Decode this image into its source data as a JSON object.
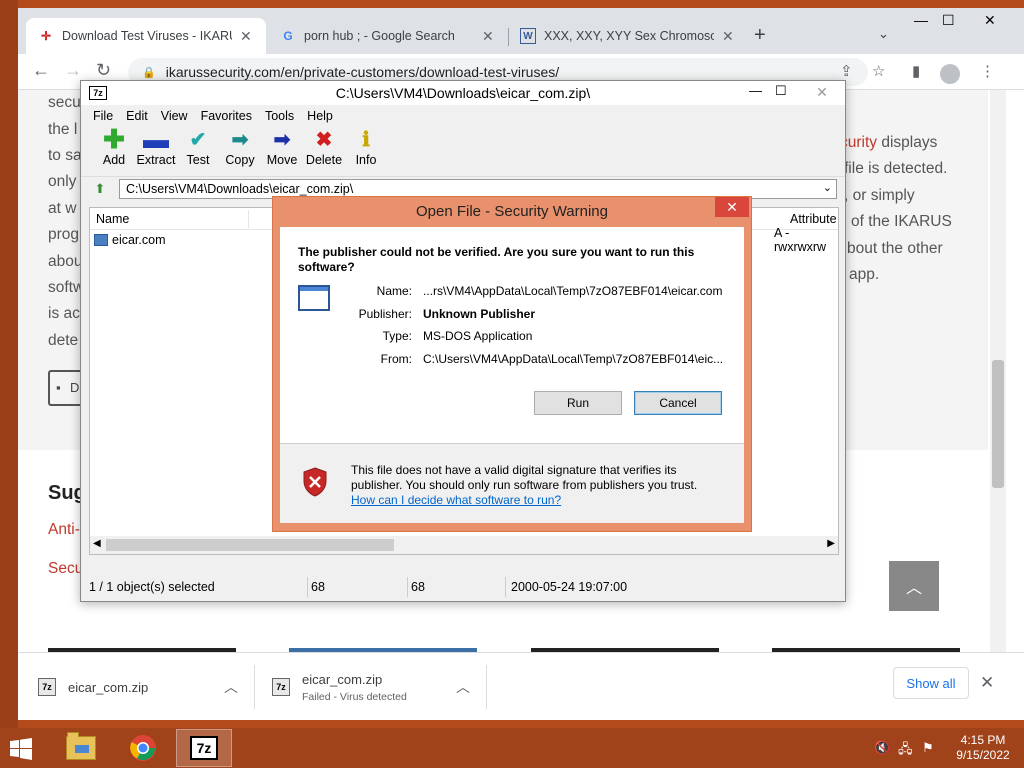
{
  "browser": {
    "tabs": [
      {
        "title": "Download Test Viruses - IKARUS",
        "favicon": "ikarus-favicon",
        "active": true
      },
      {
        "title": "porn hub ; - Google Search",
        "favicon": "google-favicon",
        "active": false
      },
      {
        "title": "XXX, XXY, XYY Sex Chromosome",
        "favicon": "wiki-favicon",
        "active": false
      }
    ],
    "url": "ikarussecurity.com/en/private-customers/download-test-viruses/"
  },
  "page": {
    "left_fragments": [
      "secu",
      "the l",
      "to sa",
      "only",
      "at w",
      "prog",
      "abou",
      "softw",
      "is ac",
      "dete"
    ],
    "right_fragments": [
      {
        "text": "curity",
        "suffix": " displays"
      },
      {
        "text": "file is detected.",
        "suffix": ""
      },
      {
        "text": ", or simply",
        "suffix": ""
      },
      {
        "text": "of the IKARUS",
        "suffix": ""
      },
      {
        "text": "bout the other",
        "suffix": ""
      },
      {
        "text": "app.",
        "suffix": ""
      }
    ],
    "heading_fragment": "Sug",
    "link_fragments": [
      "Anti-",
      "Secu"
    ],
    "download_btn_fragment": "D"
  },
  "zip": {
    "title": "C:\\Users\\VM4\\Downloads\\eicar_com.zip\\",
    "logo": "7z",
    "menu": [
      "File",
      "Edit",
      "View",
      "Favorites",
      "Tools",
      "Help"
    ],
    "tools": [
      {
        "label": "Add",
        "icon": "plus-icon",
        "color": "#2eaa2e"
      },
      {
        "label": "Extract",
        "icon": "minus-icon",
        "color": "#1f3fb8"
      },
      {
        "label": "Test",
        "icon": "check-icon",
        "color": "#21a8a8"
      },
      {
        "label": "Copy",
        "icon": "copy-arrow-icon",
        "color": "#1a8a8a"
      },
      {
        "label": "Move",
        "icon": "move-arrow-icon",
        "color": "#1f2fa8"
      },
      {
        "label": "Delete",
        "icon": "delete-x-icon",
        "color": "#d01f1f"
      },
      {
        "label": "Info",
        "icon": "info-icon",
        "color": "#c8a800"
      }
    ],
    "path": "C:\\Users\\VM4\\Downloads\\eicar_com.zip\\",
    "columns": {
      "name": "Name",
      "attributes": "Attribute"
    },
    "files": [
      {
        "name": "eicar.com",
        "attributes": "A -rwxrwxrw"
      }
    ],
    "status": {
      "selected": "1 / 1 object(s) selected",
      "size": "68",
      "packed": "68",
      "modified": "2000-05-24 19:07:00"
    }
  },
  "dialog": {
    "title": "Open File - Security Warning",
    "question": "The publisher could not be verified.  Are you sure you want to run this software?",
    "fields": [
      {
        "label": "Name:",
        "value": "...rs\\VM4\\AppData\\Local\\Temp\\7zO87EBF014\\eicar.com",
        "bold": false
      },
      {
        "label": "Publisher:",
        "value": "Unknown Publisher",
        "bold": true
      },
      {
        "label": "Type:",
        "value": "MS-DOS Application",
        "bold": false
      },
      {
        "label": "From:",
        "value": "C:\\Users\\VM4\\AppData\\Local\\Temp\\7zO87EBF014\\eic...",
        "bold": false
      }
    ],
    "run": "Run",
    "cancel": "Cancel",
    "note": "This file does not have a valid digital signature that verifies its publisher.  You should only run software from publishers you trust.",
    "link": "How can I decide what software to run?"
  },
  "downloads": {
    "items": [
      {
        "name": "eicar_com.zip",
        "status": ""
      },
      {
        "name": "eicar_com.zip",
        "status": "Failed - Virus detected"
      }
    ],
    "show_all": "Show all"
  },
  "taskbar": {
    "time": "4:15 PM",
    "date": "9/15/2022",
    "apps": [
      {
        "name": "file-explorer-icon"
      },
      {
        "name": "chrome-icon"
      },
      {
        "name": "7zip-icon",
        "label": "7z"
      }
    ]
  },
  "colors": {
    "accent_red": "#c0392b",
    "dialog_frame": "#e9916c",
    "link_blue": "#0066cc",
    "chrome_blue": "#1a73e8",
    "taskbar": "#a0421a"
  }
}
